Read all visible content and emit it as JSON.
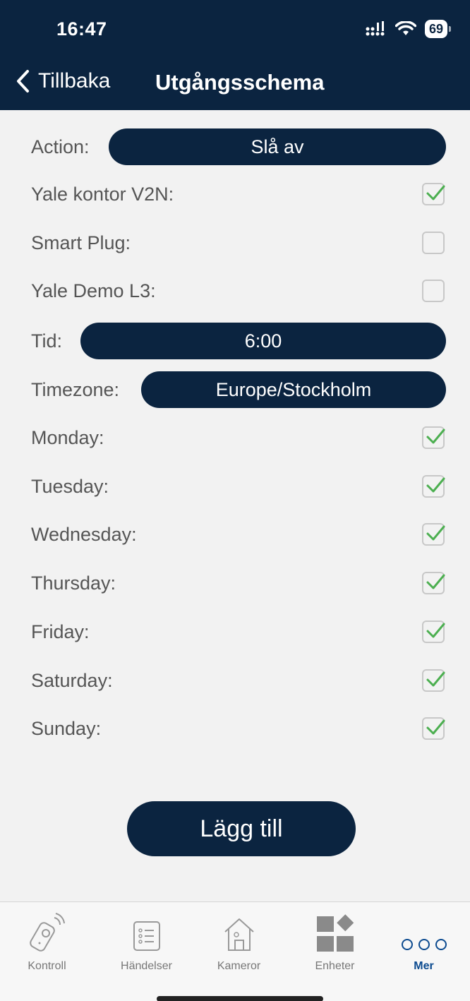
{
  "status": {
    "time": "16:47",
    "battery": "69"
  },
  "nav": {
    "back_label": "Tillbaka",
    "title": "Utgångsschema"
  },
  "form": {
    "action": {
      "label": "Action:",
      "value": "Slå av"
    },
    "devices": [
      {
        "label": "Yale kontor V2N:",
        "checked": true
      },
      {
        "label": "Smart Plug:",
        "checked": false
      },
      {
        "label": "Yale Demo L3:",
        "checked": false
      }
    ],
    "time": {
      "label": "Tid:",
      "value": "6:00"
    },
    "timezone": {
      "label": "Timezone:",
      "value": "Europe/Stockholm"
    },
    "days": [
      {
        "label": "Monday:",
        "checked": true
      },
      {
        "label": "Tuesday:",
        "checked": true
      },
      {
        "label": "Wednesday:",
        "checked": true
      },
      {
        "label": "Thursday:",
        "checked": true
      },
      {
        "label": "Friday:",
        "checked": true
      },
      {
        "label": "Saturday:",
        "checked": true
      },
      {
        "label": "Sunday:",
        "checked": true
      }
    ],
    "submit_label": "Lägg till"
  },
  "tabs": [
    {
      "label": "Kontroll",
      "icon": "remote-control-icon",
      "active": false
    },
    {
      "label": "Händelser",
      "icon": "event-list-icon",
      "active": false
    },
    {
      "label": "Kameror",
      "icon": "house-camera-icon",
      "active": false
    },
    {
      "label": "Enheter",
      "icon": "devices-grid-icon",
      "active": false
    },
    {
      "label": "Mer",
      "icon": "more-dots-icon",
      "active": true
    }
  ],
  "colors": {
    "navy": "#0b2440",
    "check_green": "#4caf50",
    "active_tab": "#0b4a8f"
  }
}
